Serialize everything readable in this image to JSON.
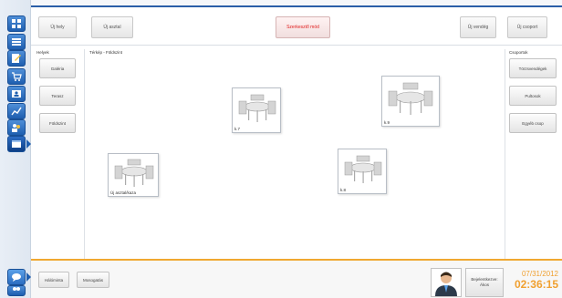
{
  "toolbar": {
    "new_place": "Új hely",
    "new_table": "Új asztal",
    "edit_disabled": "Szerkesztő mód",
    "new_item": "Új vendég",
    "new_group": "Új csoport",
    "colors": {
      "edit_disabled": "#e02020"
    }
  },
  "helyek": {
    "title": "Helyek",
    "items": [
      "Galéria",
      "Terasz",
      "Földszint"
    ]
  },
  "floor": {
    "title": "Térkép - Földszint",
    "tables": [
      {
        "label": "k.7"
      },
      {
        "label": "k.9"
      },
      {
        "label": "Új asztal/kaza"
      },
      {
        "label": "k.8"
      }
    ]
  },
  "csoportok": {
    "title": "Csoportok",
    "items": [
      "Törzsvendégek",
      "Pultosok",
      "Egyéb csop"
    ]
  },
  "bottom": {
    "btn1": "Hálóminta",
    "btn2": "Mosogatás",
    "user_name": "Bejelentkezve: Ákos",
    "date": "07/31/2012",
    "time": "02:36:15"
  },
  "rail_icons": [
    "grid-icon",
    "list-icon",
    "edit-icon",
    "cart-icon",
    "user-card-icon",
    "chart-icon",
    "users-icon",
    "window-icon",
    "chat-icon",
    "people-icon"
  ]
}
